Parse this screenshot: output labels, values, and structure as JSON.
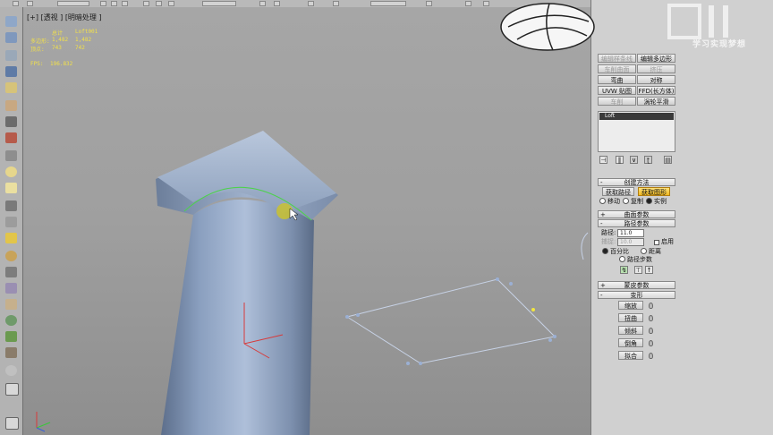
{
  "viewport": {
    "label": "[+] [透视 ] [明暗处理 ]",
    "stats": {
      "header_total": "总计",
      "header_object": "Loft001",
      "polys_label": "多边形:",
      "polys_total": "1,482",
      "polys_object": "1,482",
      "verts_label": "顶点:",
      "verts_total": "743",
      "verts_object": "742",
      "fps_label": "FPS:",
      "fps_value": "196.832"
    }
  },
  "panel": {
    "modifier_buttons": [
      {
        "label": "编辑样条线",
        "state": "disabled"
      },
      {
        "label": "编辑多边形",
        "state": "normal"
      },
      {
        "label": "车削曲面",
        "state": "disabled"
      },
      {
        "label": "挤压",
        "state": "disabled"
      },
      {
        "label": "弯曲",
        "state": "normal"
      },
      {
        "label": "对称",
        "state": "normal"
      },
      {
        "label": "UVW 贴图",
        "state": "normal"
      },
      {
        "label": "FFD(长方体)",
        "state": "normal"
      },
      {
        "label": "车削",
        "state": "disabled"
      },
      {
        "label": "涡轮平滑",
        "state": "normal"
      }
    ],
    "stack_item": "Loft",
    "creation_method": {
      "title": "创建方法",
      "get_path": "获取路径",
      "get_shape": "获取图形",
      "move": "移动",
      "copy": "复制",
      "instance": "实例"
    },
    "surface_params": {
      "title": "曲面参数"
    },
    "path_params": {
      "title": "路径参数",
      "path_label": "路径:",
      "path_value": "11.0",
      "snap_label": "捕捉:",
      "snap_value": "10.0",
      "enable_label": "启用",
      "percentage": "百分比",
      "distance": "距离",
      "path_steps": "路径步数"
    },
    "skin_params": {
      "title": "蒙皮参数"
    },
    "deformations": {
      "title": "变形",
      "items": [
        "缩放",
        "扭曲",
        "倾斜",
        "倒角",
        "拟合"
      ]
    }
  },
  "watermark": "学习实现梦想",
  "colors": {
    "selection_highlight": "#f0b81e",
    "stats_text": "#f2e04a",
    "column_blue": "#8a9fbf"
  }
}
